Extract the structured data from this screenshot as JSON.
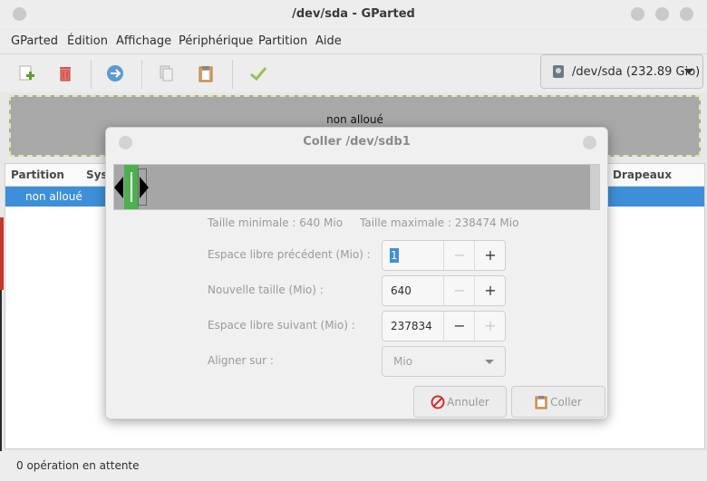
{
  "window": {
    "title": "/dev/sda - GParted"
  },
  "menubar": {
    "items": [
      "GParted",
      "Édition",
      "Affichage",
      "Périphérique",
      "Partition",
      "Aide"
    ]
  },
  "toolbar": {
    "icons": [
      "new-partition-icon",
      "delete-icon",
      "resize-move-icon",
      "copy-icon",
      "paste-icon",
      "apply-icon"
    ],
    "device": {
      "label": "/dev/sda (232.89 Gio)",
      "icon": "disk-icon"
    }
  },
  "disk_map": {
    "label": "non alloué"
  },
  "partition_list": {
    "columns": [
      "Partition",
      "Sys",
      "Drapeaux"
    ],
    "rows": [
      {
        "partition": "non alloué"
      }
    ]
  },
  "statusbar": {
    "text": "0 opération en attente"
  },
  "dialog": {
    "title": "Coller /dev/sdb1",
    "min_size_label": "Taille minimale : 640 Mio",
    "max_size_label": "Taille maximale : 238474 Mio",
    "free_before": {
      "label": "Espace libre précédent (Mio) :",
      "value": "1"
    },
    "new_size": {
      "label": "Nouvelle taille (Mio) :",
      "value": "640"
    },
    "free_after": {
      "label": "Espace libre suivant (Mio) :",
      "value": "237834"
    },
    "align": {
      "label": "Aligner sur :",
      "value": "Mio"
    },
    "buttons": {
      "cancel": "Annuler",
      "paste": "Coller"
    },
    "stepper": {
      "minus": "−",
      "plus": "+"
    }
  },
  "colors": {
    "selection": "#3d8fd9",
    "partition_green": "#4caf50",
    "unallocated": "#a8a8a8"
  }
}
